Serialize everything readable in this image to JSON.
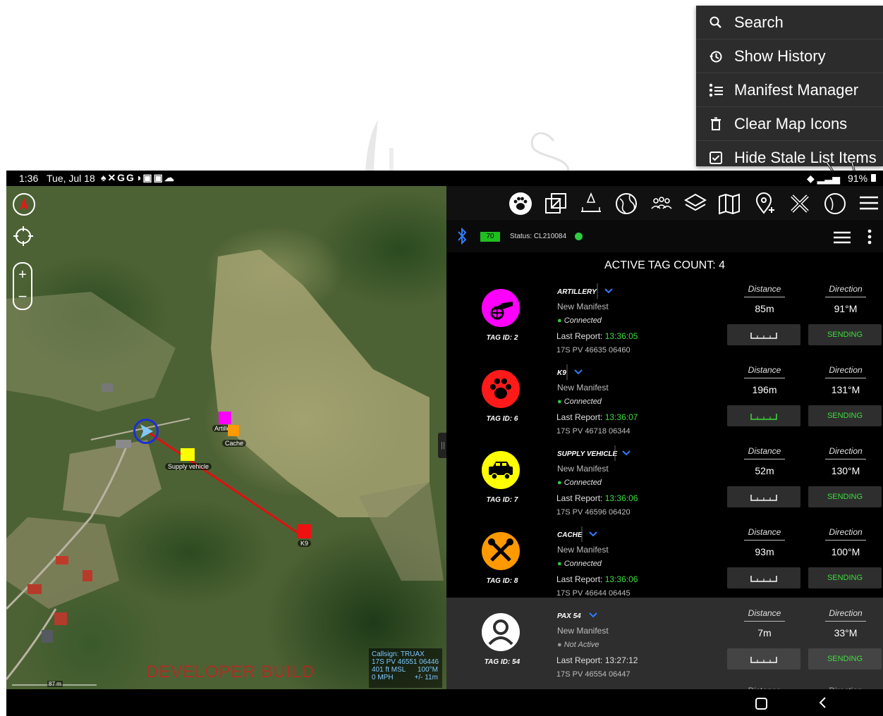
{
  "menu": {
    "items": [
      {
        "label": "Search",
        "icon": "search-icon"
      },
      {
        "label": "Show History",
        "icon": "history-icon"
      },
      {
        "label": "Manifest Manager",
        "icon": "manifest-list-icon"
      },
      {
        "label": "Clear Map Icons",
        "icon": "trash-icon"
      },
      {
        "label": "Hide Stale List Items",
        "icon": "checkbox-icon"
      }
    ]
  },
  "statusbar": {
    "time": "1:36",
    "date": "Tue, Jul 18",
    "battery": "91%"
  },
  "map": {
    "markers": {
      "artillery": "Artillery",
      "cache": "Cache",
      "supply": "Supply vehicle",
      "k9": "K9"
    },
    "watermark": "DEVELOPER BUILD",
    "scale": "87 m",
    "info": {
      "callsign": "Callsign: TRUAX",
      "coord": "17S PV 46551 06446",
      "alt": "401 ft MSL",
      "heading": "100°M",
      "speed": "0 MPH",
      "accuracy": "+/- 11m"
    }
  },
  "panel": {
    "battery_level": "70",
    "status": "Status: CL210084",
    "active_count_label": "ACTIVE TAG COUNT:",
    "active_count": "4",
    "distance_label": "Distance",
    "direction_label": "Direction",
    "tags": [
      {
        "name": "ARTILLERY",
        "manifest": "New Manifest",
        "state": "Connected",
        "last_label": "Last Report:",
        "time": "13:36:05",
        "coord": "17S PV 46635 06460",
        "tag_id": "TAG ID: 2",
        "distance": "85m",
        "direction": "91°M",
        "send": "SENDING",
        "color": "#ff00ff"
      },
      {
        "name": "K9",
        "manifest": "New Manifest",
        "state": "Connected",
        "last_label": "Last Report:",
        "time": "13:36:07",
        "coord": "17S PV 46718 06344",
        "tag_id": "TAG ID: 6",
        "distance": "196m",
        "direction": "131°M",
        "send": "SENDING",
        "color": "#ff1a1a"
      },
      {
        "name": "SUPPLY VEHICLE",
        "manifest": "New Manifest",
        "state": "Connected",
        "last_label": "Last Report:",
        "time": "13:36:06",
        "coord": "17S PV 46596 06420",
        "tag_id": "TAG ID: 7",
        "distance": "52m",
        "direction": "130°M",
        "send": "SENDING",
        "color": "#ffff00"
      },
      {
        "name": "CACHE",
        "manifest": "New Manifest",
        "state": "Connected",
        "last_label": "Last Report:",
        "time": "13:36:06",
        "coord": "17S PV 46644 06445",
        "tag_id": "TAG ID: 8",
        "distance": "93m",
        "direction": "100°M",
        "send": "SENDING",
        "color": "#ff9900"
      },
      {
        "name": "PAX 54",
        "manifest": "New Manifest",
        "state": "Not Active",
        "last_label": "Last Report:",
        "time": "13:27:12",
        "coord": "17S PV 46554 06447",
        "tag_id": "TAG ID: 54",
        "distance": "7m",
        "direction": "33°M",
        "send": "SENDING",
        "color": "#ffffff"
      }
    ],
    "partial_distance": "Distance",
    "partial_direction": "Direction"
  }
}
